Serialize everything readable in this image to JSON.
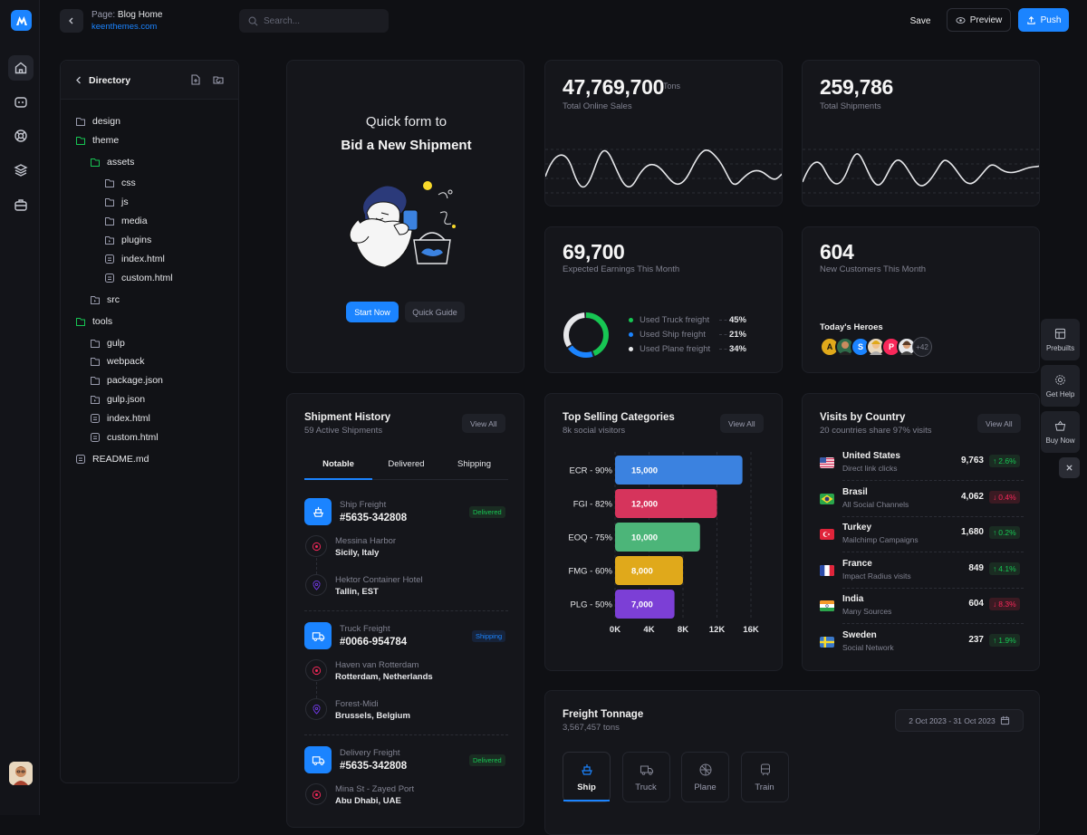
{
  "header": {
    "page_label": "Page:",
    "page_name": "Blog Home",
    "site": "keenthemes.com",
    "search_placeholder": "Search...",
    "save": "Save",
    "preview": "Preview",
    "push": "Push"
  },
  "directory": {
    "title": "Directory",
    "items": [
      "design",
      "theme",
      "assets",
      "css",
      "js",
      "media",
      "plugins",
      "index.html",
      "custom.html",
      "src",
      "tools",
      "gulp",
      "webpack",
      "package.json",
      "gulp.json",
      "index.html",
      "custom.html",
      "README.md"
    ]
  },
  "quick_form": {
    "line1": "Quick form to",
    "line2": "Bid a New Shipment",
    "start": "Start Now",
    "guide": "Quick Guide"
  },
  "stats": {
    "sales_value": "47,769,700",
    "sales_unit": "Tons",
    "sales_label": "Total Online Sales",
    "ship_value": "259,786",
    "ship_label": "Total Shipments",
    "earn_value": "69,700",
    "earn_label": "Expected Earnings This Month",
    "cust_value": "604",
    "cust_label": "New Customers This Month",
    "heroes": "Today's Heroes",
    "hero_more": "+42",
    "hero_initials": [
      "A",
      "S",
      "P"
    ]
  },
  "freight_usage": [
    {
      "label": "Used Truck freight",
      "pct": "45%",
      "color": "#17c653"
    },
    {
      "label": "Used Ship freight",
      "pct": "21%",
      "color": "#1b84ff"
    },
    {
      "label": "Used Plane freight",
      "pct": "34%",
      "color": "#e6e7ea"
    }
  ],
  "shipment_history": {
    "title": "Shipment History",
    "subtitle": "59 Active Shipments",
    "view_all": "View All",
    "tabs": [
      "Notable",
      "Delivered",
      "Shipping"
    ],
    "items": [
      {
        "type": "Ship Freight",
        "id": "#5635-342808",
        "status": "Delivered",
        "from_label": "Messina Harbor",
        "from": "Sicily, Italy",
        "to_label": "Hektor Container Hotel",
        "to": "Tallin, EST"
      },
      {
        "type": "Truck Freight",
        "id": "#0066-954784",
        "status": "Shipping",
        "from_label": "Haven van Rotterdam",
        "from": "Rotterdam, Netherlands",
        "to_label": "Forest-Midi",
        "to": "Brussels, Belgium"
      },
      {
        "type": "Delivery Freight",
        "id": "#5635-342808",
        "status": "Delivered",
        "from_label": "Mina St - Zayed Port",
        "from": "Abu Dhabi, UAE"
      }
    ]
  },
  "top_selling": {
    "title": "Top Selling Categories",
    "subtitle": "8k social visitors",
    "view_all": "View All"
  },
  "chart_data": {
    "type": "bar",
    "orientation": "horizontal",
    "categories": [
      "ECR - 90%",
      "FGI - 82%",
      "EOQ - 75%",
      "FMG - 60%",
      "PLG - 50%"
    ],
    "values": [
      15000,
      12000,
      10000,
      8000,
      7000
    ],
    "value_labels": [
      "15,000",
      "12,000",
      "10,000",
      "8,000",
      "7,000"
    ],
    "colors": [
      "#3b82e0",
      "#d6345c",
      "#4cb579",
      "#e0a91b",
      "#7c3fd6"
    ],
    "xlim": [
      0,
      16000
    ],
    "x_ticks": [
      "0K",
      "4K",
      "8K",
      "12K",
      "16K"
    ],
    "grid": true
  },
  "visits_by_country": {
    "title": "Visits by Country",
    "subtitle": "20 countries share 97% visits",
    "view_all": "View All",
    "rows": [
      {
        "country": "United States",
        "source": "Direct link clicks",
        "value": "9,763",
        "change": "2.6%",
        "up": true
      },
      {
        "country": "Brasil",
        "source": "All Social Channels",
        "value": "4,062",
        "change": "0.4%",
        "up": false
      },
      {
        "country": "Turkey",
        "source": "Mailchimp Campaigns",
        "value": "1,680",
        "change": "0.2%",
        "up": true
      },
      {
        "country": "France",
        "source": "Impact Radius visits",
        "value": "849",
        "change": "4.1%",
        "up": true
      },
      {
        "country": "India",
        "source": "Many Sources",
        "value": "604",
        "change": "8.3%",
        "up": false
      },
      {
        "country": "Sweden",
        "source": "Social Network",
        "value": "237",
        "change": "1.9%",
        "up": true
      }
    ]
  },
  "freight_tonnage": {
    "title": "Freight Tonnage",
    "subtitle": "3,567,457 tons",
    "date_range": "2 Oct 2023 - 31 Oct 2023",
    "modes": [
      "Ship",
      "Truck",
      "Plane",
      "Train"
    ]
  },
  "side_actions": [
    "Prebuilts",
    "Get Help",
    "Buy Now"
  ]
}
